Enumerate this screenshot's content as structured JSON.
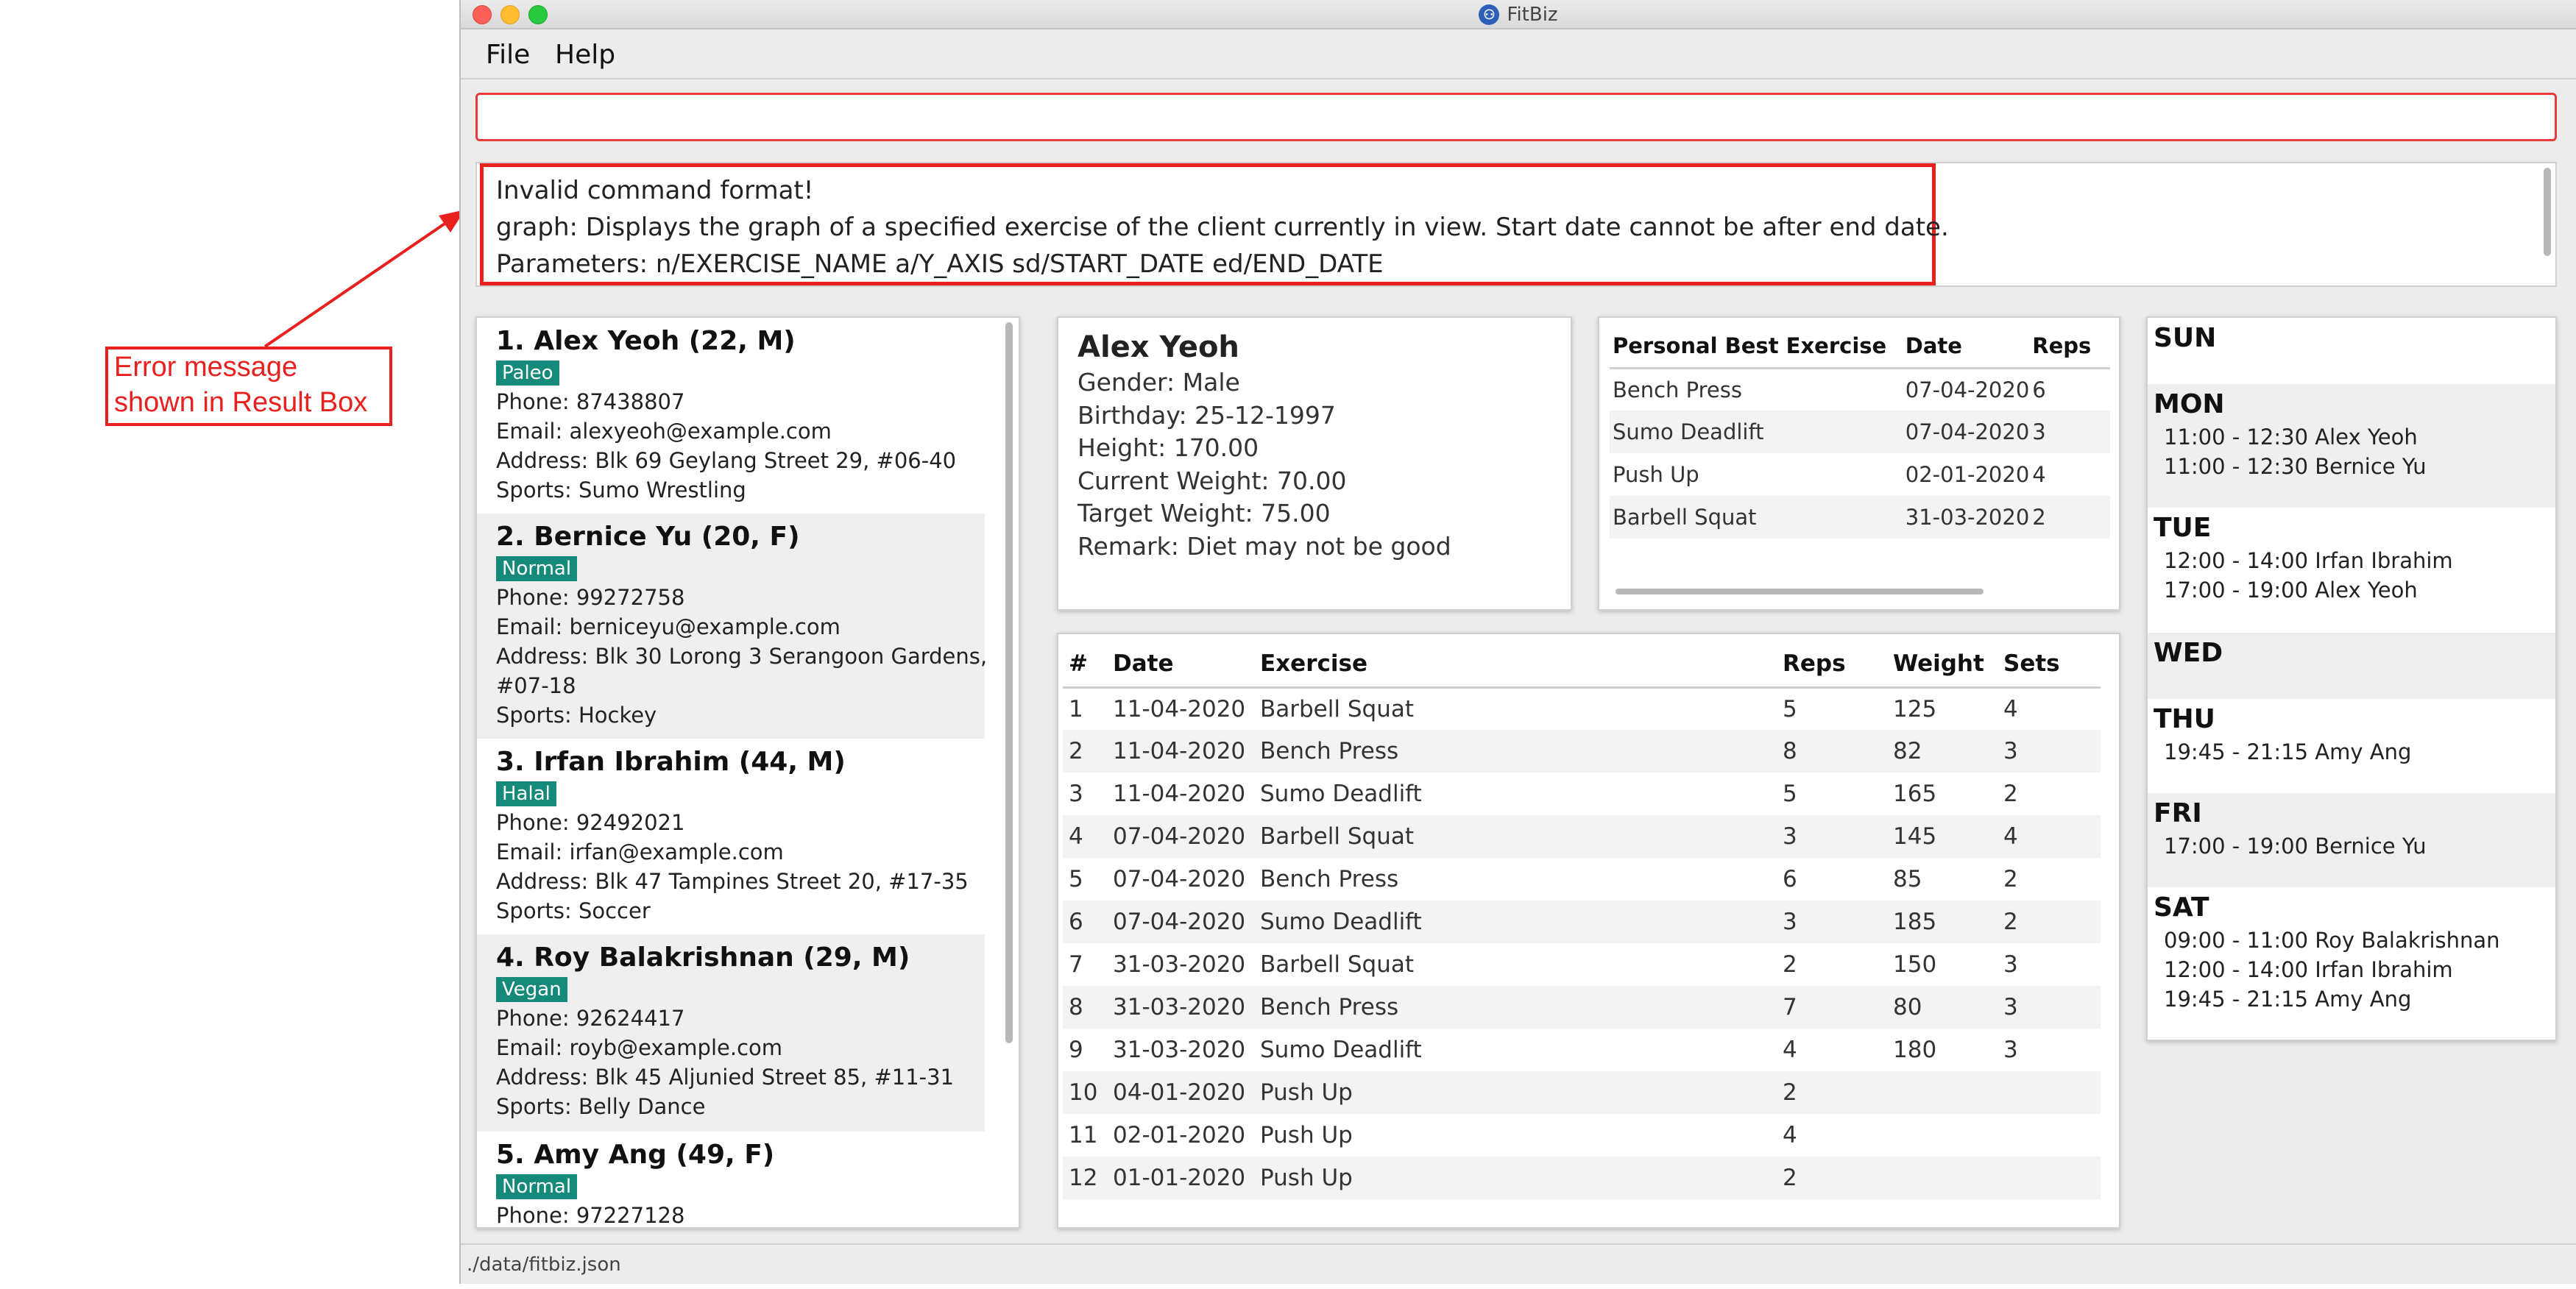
{
  "annotation": {
    "lines": [
      "Error message",
      "shown in Result Box"
    ],
    "color": "#e8211e"
  },
  "window": {
    "title": "FitBiz",
    "icon": "fitbiz-logo-icon"
  },
  "menu": {
    "file": "File",
    "help": "Help"
  },
  "command_box": {
    "value": "",
    "placeholder": ""
  },
  "result": {
    "lines": [
      "Invalid command format!",
      "graph: Displays the graph of a specified exercise of the client currently in view. Start date cannot be after end date.",
      "Parameters: n/EXERCISE_NAME a/Y_AXIS sd/START_DATE ed/END_DATE"
    ]
  },
  "clients": [
    {
      "index": "1.",
      "name": "Alex Yeoh (22, M)",
      "tag": "Paleo",
      "phone": "Phone: 87438807",
      "email": "Email: alexyeoh@example.com",
      "address": [
        "Address: Blk 69 Geylang Street 29, #06-40"
      ],
      "sports": "Sports: Sumo Wrestling"
    },
    {
      "index": "2.",
      "name": "Bernice Yu (20, F)",
      "tag": "Normal",
      "phone": "Phone: 99272758",
      "email": "Email: berniceyu@example.com",
      "address": [
        "Address: Blk 30 Lorong 3 Serangoon Gardens,",
        "#07-18"
      ],
      "sports": "Sports: Hockey"
    },
    {
      "index": "3.",
      "name": "Irfan Ibrahim (44, M)",
      "tag": "Halal",
      "phone": "Phone: 92492021",
      "email": "Email: irfan@example.com",
      "address": [
        "Address: Blk 47 Tampines Street 20, #17-35"
      ],
      "sports": "Sports: Soccer"
    },
    {
      "index": "4.",
      "name": "Roy Balakrishnan (29, M)",
      "tag": "Vegan",
      "phone": "Phone: 92624417",
      "email": "Email: royb@example.com",
      "address": [
        "Address: Blk 45 Aljunied Street 85, #11-31"
      ],
      "sports": "Sports: Belly Dance"
    },
    {
      "index": "5.",
      "name": "Amy Ang (49, F)",
      "tag": "Normal",
      "phone": "Phone: 97227128",
      "email": "",
      "address": [],
      "sports": ""
    }
  ],
  "profile": {
    "name": "Alex Yeoh",
    "gender": "Gender: Male",
    "birthday": "Birthday: 25-12-1997",
    "height": "Height: 170.00",
    "current_weight": "Current Weight: 70.00",
    "target_weight": "Target Weight: 75.00",
    "remark": "Remark: Diet may not be good"
  },
  "personal_best": {
    "headers": [
      "Personal Best Exercise",
      "Date",
      "Reps"
    ],
    "rows": [
      [
        "Bench Press",
        "07-04-2020",
        "6"
      ],
      [
        "Sumo Deadlift",
        "07-04-2020",
        "3"
      ],
      [
        "Push Up",
        "02-01-2020",
        "4"
      ],
      [
        "Barbell Squat",
        "31-03-2020",
        "2"
      ]
    ]
  },
  "exercises": {
    "headers": [
      "#",
      "Date",
      "Exercise",
      "Reps",
      "Weight",
      "Sets"
    ],
    "rows": [
      [
        "1",
        "11-04-2020",
        "Barbell Squat",
        "5",
        "125",
        "4"
      ],
      [
        "2",
        "11-04-2020",
        "Bench Press",
        "8",
        "82",
        "3"
      ],
      [
        "3",
        "11-04-2020",
        "Sumo Deadlift",
        "5",
        "165",
        "2"
      ],
      [
        "4",
        "07-04-2020",
        "Barbell Squat",
        "3",
        "145",
        "4"
      ],
      [
        "5",
        "07-04-2020",
        "Bench Press",
        "6",
        "85",
        "2"
      ],
      [
        "6",
        "07-04-2020",
        "Sumo Deadlift",
        "3",
        "185",
        "2"
      ],
      [
        "7",
        "31-03-2020",
        "Barbell Squat",
        "2",
        "150",
        "3"
      ],
      [
        "8",
        "31-03-2020",
        "Bench Press",
        "7",
        "80",
        "3"
      ],
      [
        "9",
        "31-03-2020",
        "Sumo Deadlift",
        "4",
        "180",
        "3"
      ],
      [
        "10",
        "04-01-2020",
        "Push Up",
        "2",
        "",
        ""
      ],
      [
        "11",
        "02-01-2020",
        "Push Up",
        "4",
        "",
        ""
      ],
      [
        "12",
        "01-01-2020",
        "Push Up",
        "2",
        "",
        ""
      ]
    ]
  },
  "schedule": [
    {
      "day": "SUN",
      "entries": []
    },
    {
      "day": "MON",
      "entries": [
        "11:00 - 12:30 Alex Yeoh",
        "11:00 - 12:30 Bernice Yu"
      ]
    },
    {
      "day": "TUE",
      "entries": [
        "12:00 - 14:00 Irfan Ibrahim",
        "17:00 - 19:00 Alex Yeoh"
      ]
    },
    {
      "day": "WED",
      "entries": []
    },
    {
      "day": "THU",
      "entries": [
        "19:45 - 21:15 Amy Ang"
      ]
    },
    {
      "day": "FRI",
      "entries": [
        "17:00 - 19:00 Bernice Yu"
      ]
    },
    {
      "day": "SAT",
      "entries": [
        "09:00 - 11:00 Roy Balakrishnan",
        "12:00 - 14:00 Irfan Ibrahim",
        "19:45 - 21:15 Amy Ang"
      ]
    }
  ],
  "status": {
    "path": "./data/fitbiz.json"
  },
  "colors": {
    "tag": "#168a7a",
    "error_border": "#e93b3b"
  }
}
